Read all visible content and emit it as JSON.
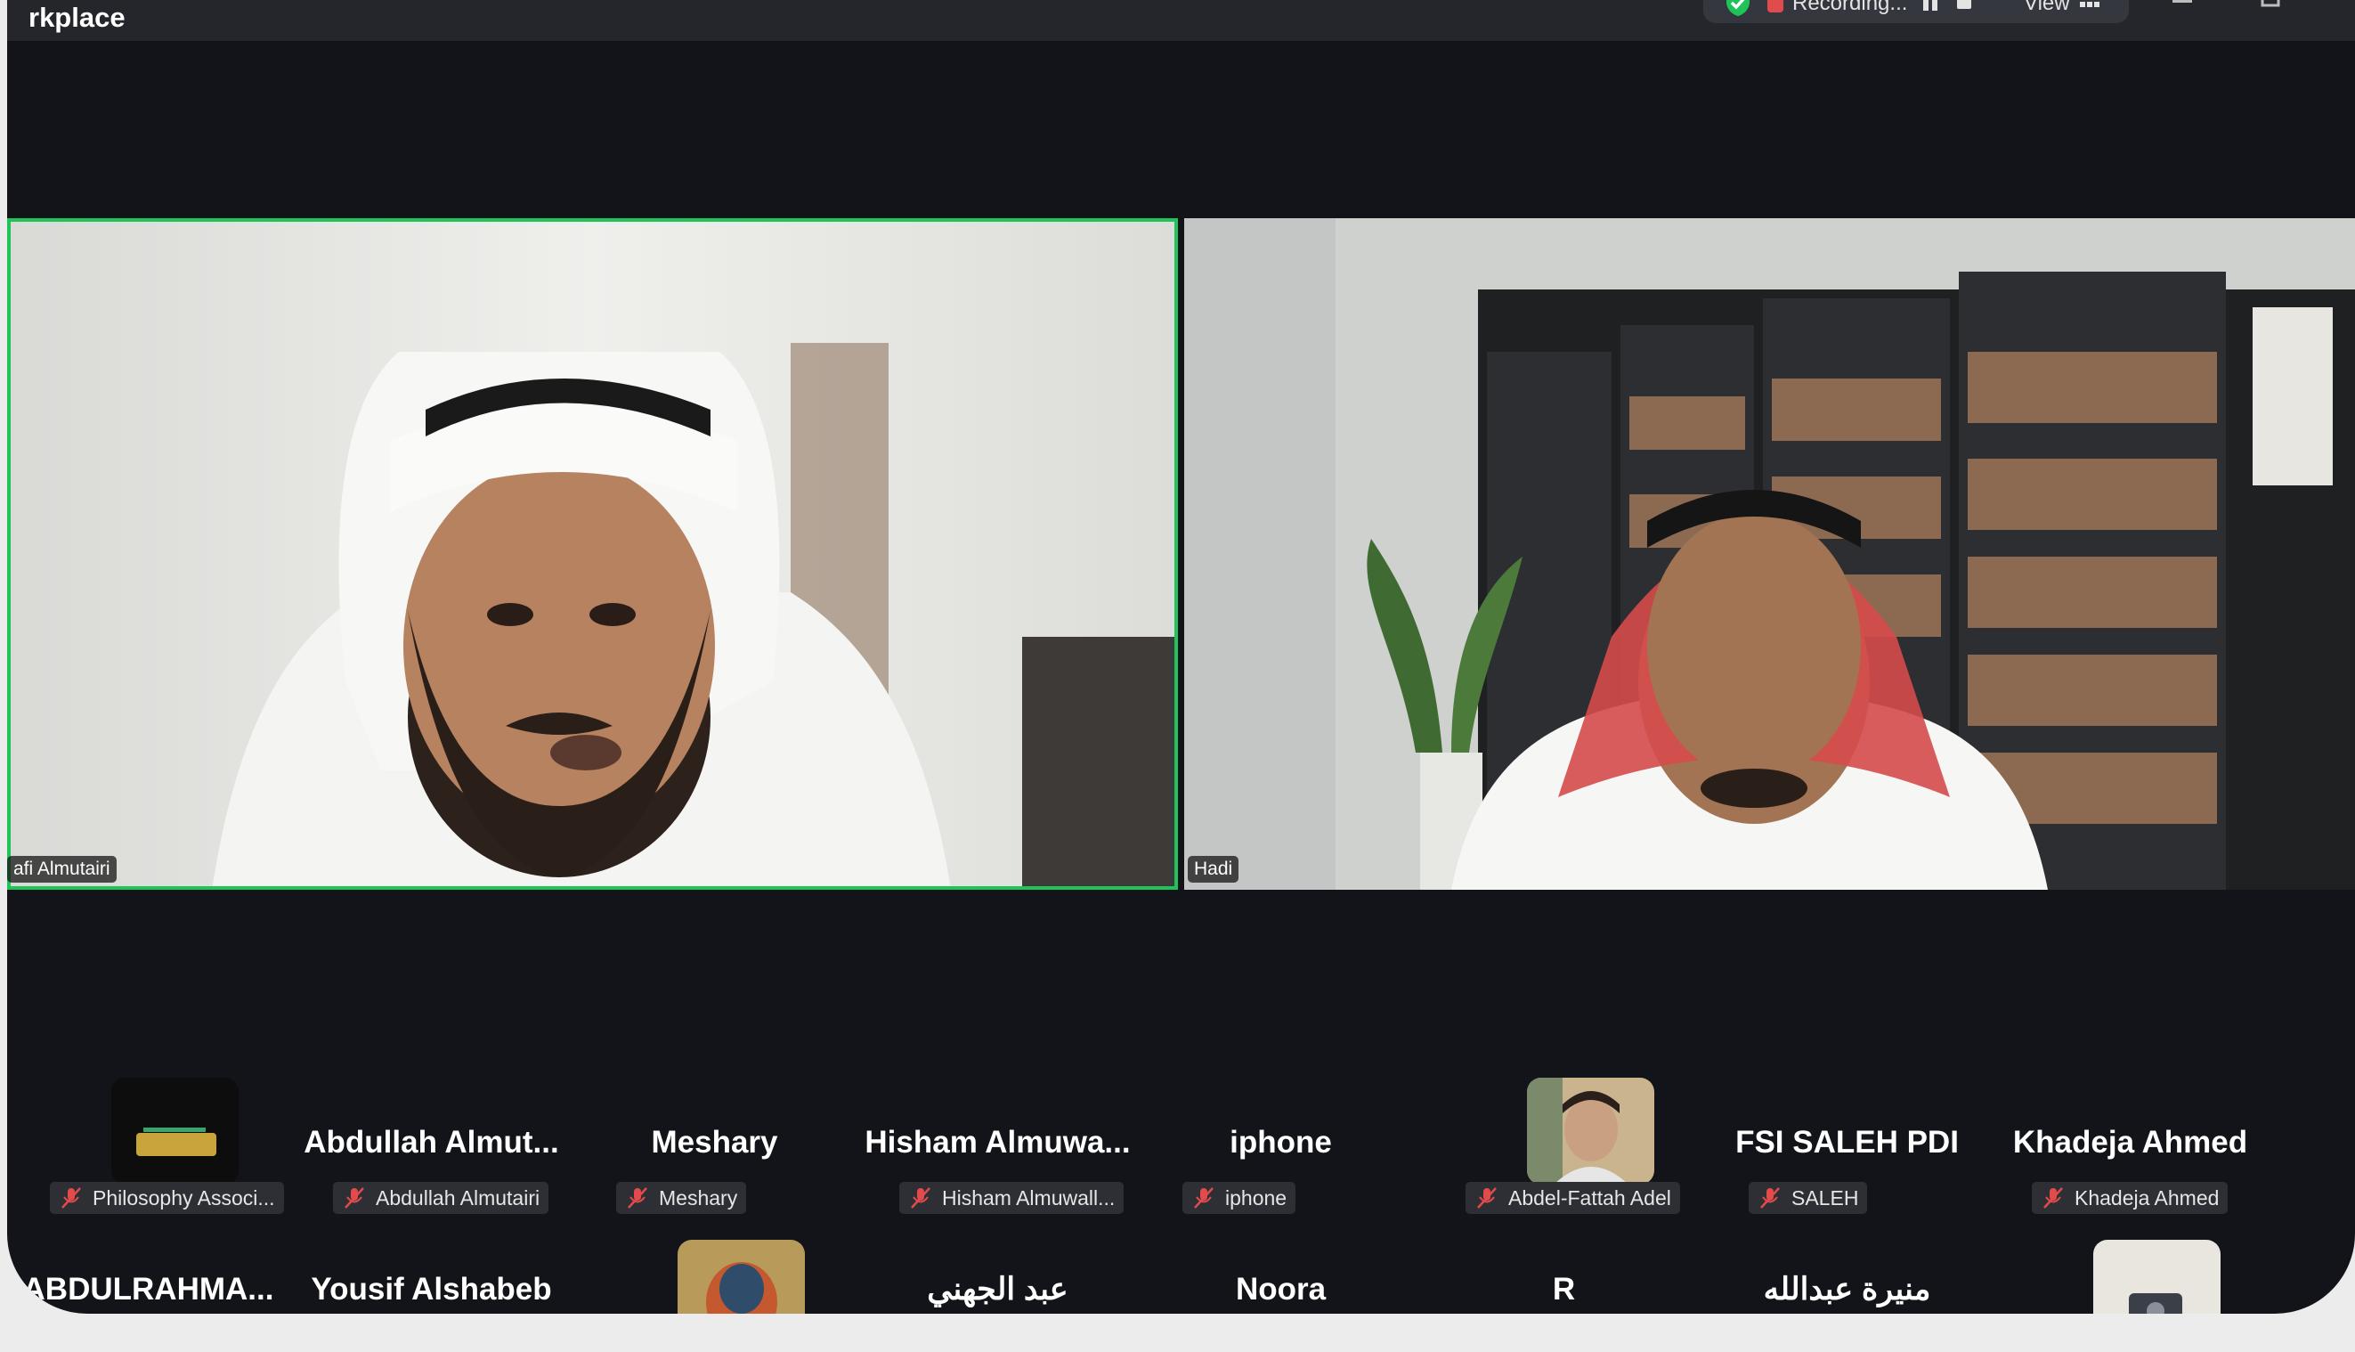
{
  "window": {
    "title": "rkplace",
    "status": {
      "recording_label": "Recording...",
      "view_label": "View"
    }
  },
  "video_tiles": [
    {
      "name": "afi Almutairi"
    },
    {
      "name": "Hadi"
    }
  ],
  "participants_row1": [
    {
      "display": "",
      "tag": "Philosophy Associ...",
      "avatar": "philosophy-logo"
    },
    {
      "display": "Abdullah  Almut...",
      "tag": "Abdullah Almutairi"
    },
    {
      "display": "Meshary",
      "tag": "Meshary"
    },
    {
      "display": "Hisham  Almuwa...",
      "tag": "Hisham Almuwall..."
    },
    {
      "display": "iphone",
      "tag": "iphone"
    },
    {
      "display": "",
      "tag": "Abdel-Fattah Adel",
      "avatar": "photo"
    },
    {
      "display": "FSI SALEH PDI",
      "tag": "SALEH"
    },
    {
      "display": "Khadeja Ahmed",
      "tag": "Khadeja Ahmed"
    }
  ],
  "participants_row2": [
    {
      "display": "ABDULRAHMA..."
    },
    {
      "display": "Yousif Alshabeb"
    },
    {
      "display": "",
      "avatar": "painting"
    },
    {
      "display": "عبد الجهني"
    },
    {
      "display": "Noora"
    },
    {
      "display": "R"
    },
    {
      "display": "منيرة عبدالله"
    },
    {
      "display": "",
      "avatar": "device"
    }
  ],
  "colors": {
    "active_speaker_border": "#1fc35a",
    "muted_mic": "#e24b4b",
    "background": "#121419"
  }
}
